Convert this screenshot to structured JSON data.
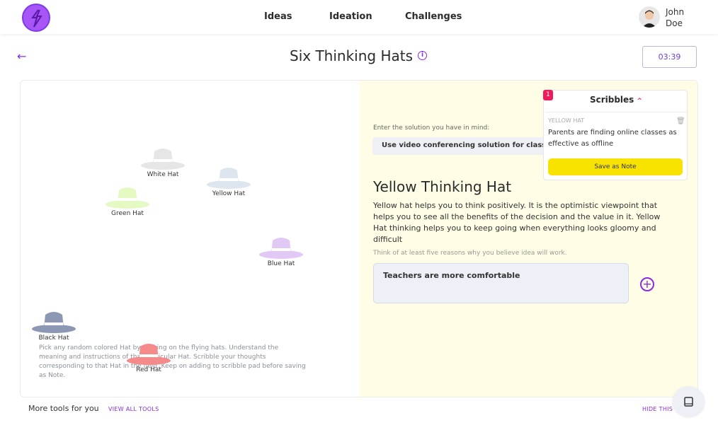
{
  "nav": {
    "links": [
      "Ideas",
      "Ideation",
      "Challenges"
    ],
    "user": {
      "first": "John",
      "last": "Doe"
    }
  },
  "header": {
    "title": "Six Thinking Hats",
    "timer": "03:39"
  },
  "hats": {
    "white": "White Hat",
    "yellow": "Yellow Hat",
    "green": "Green Hat",
    "blue": "Blue Hat",
    "black": "Black Hat",
    "red": "Red Hat"
  },
  "instructions": "Pick any random colored Hat by clicking on the flying hats. Understand the meaning and instructions of that particular Hat. Scribble your thoughts corresponding to that Hat in the field. Keep on adding to scribble pad before saving as Note.",
  "solution": {
    "label": "Enter the solution you have in mind:",
    "value": "Use video conferencing solution for classes"
  },
  "selected_hat": {
    "title": "Yellow Thinking Hat",
    "description": "Yellow hat helps you to think positively. It is the optimistic viewpoint that helps you to see all the benefits of the decision and the value in it. Yellow Hat thinking helps you to keep going when everything looks gloomy and difficult",
    "hint": "Think of at least five reasons why you believe idea will work.",
    "input_value": "Teachers are more comfortable"
  },
  "scribbles": {
    "count": "1",
    "title": "Scribbles",
    "item_tag": "YELLOW HAT",
    "item_text": "Parents are finding online classes as effective as offline",
    "save_label": "Save as Note"
  },
  "footer": {
    "more_tools": "More tools for you",
    "view_all": "VIEW ALL TOOLS",
    "hide": "HIDE THIS"
  },
  "colors": {
    "accent": "#8a2be2",
    "highlight": "#f2e600",
    "white_hat": "#e6e6e6",
    "yellow_hat": "#dde6ef",
    "green_hat": "#e5fac2",
    "blue_hat": "#e2c8f4",
    "black_hat": "#8c97b3",
    "red_hat": "#f48a8a"
  }
}
